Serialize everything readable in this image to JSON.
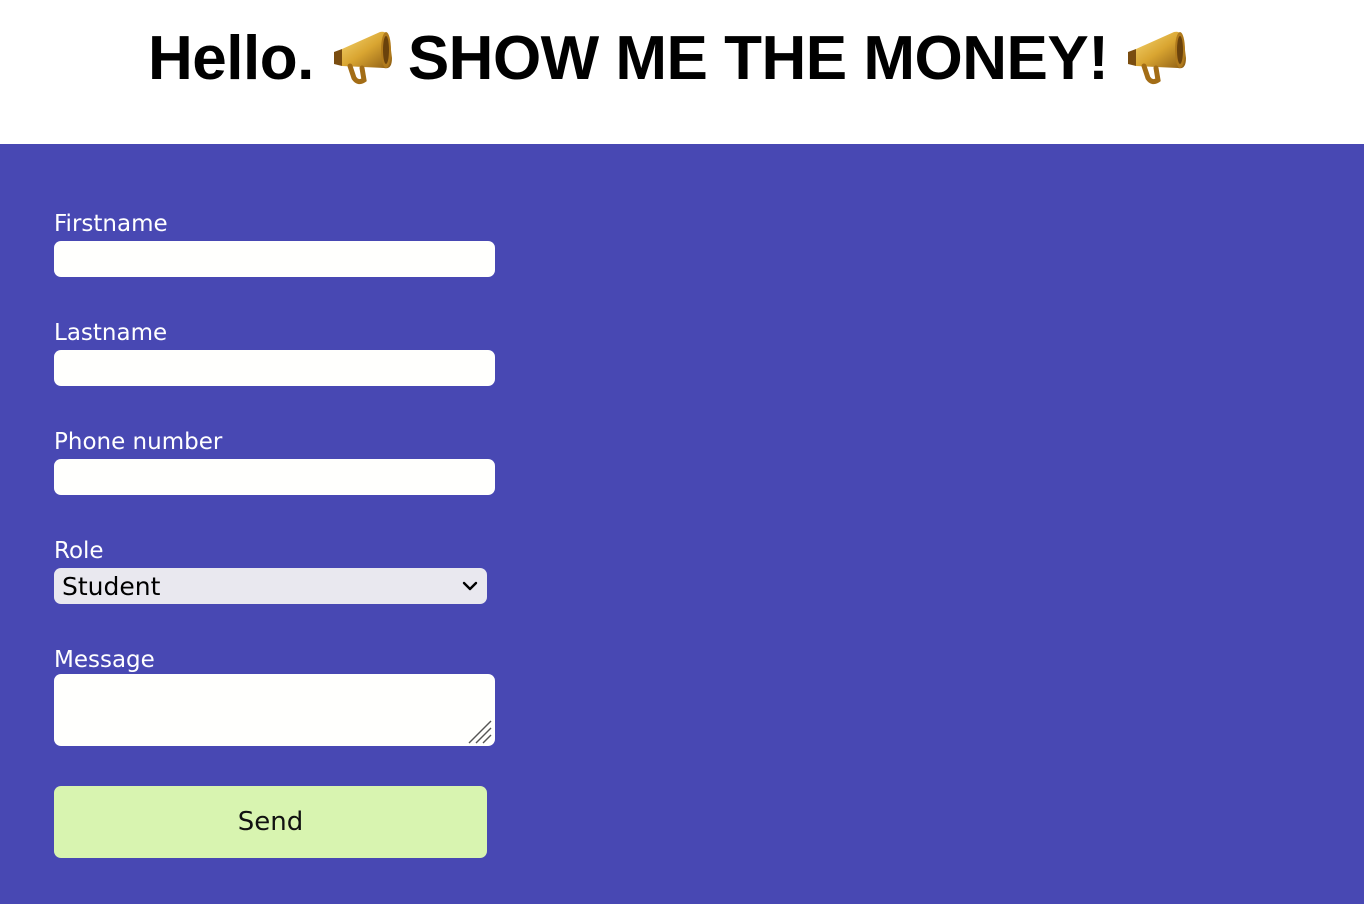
{
  "header": {
    "greeting": "Hello.",
    "slogan": "SHOW ME THE MONEY!",
    "icon": "megaphone-icon"
  },
  "form": {
    "firstname": {
      "label": "Firstname",
      "value": ""
    },
    "lastname": {
      "label": "Lastname",
      "value": ""
    },
    "phone": {
      "label": "Phone number",
      "value": ""
    },
    "role": {
      "label": "Role",
      "selected": "Student"
    },
    "message": {
      "label": "Message",
      "value": ""
    },
    "submit_label": "Send"
  },
  "colors": {
    "panel_background": "#4848b3",
    "input_background": "#fffffd",
    "select_background": "#e9e8ef",
    "button_background": "#d8f4b0",
    "label_text": "#ffffff"
  }
}
